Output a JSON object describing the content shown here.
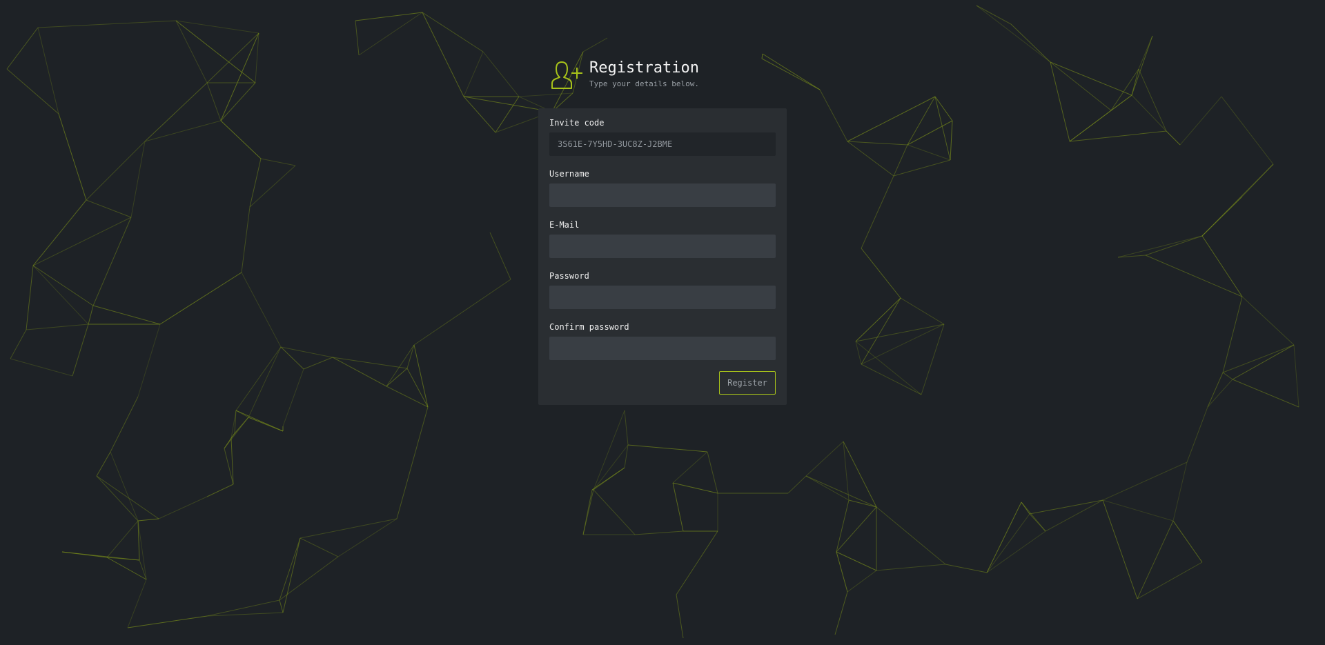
{
  "header": {
    "icon": "add-user-icon",
    "title": "Registration",
    "subtitle": "Type your details below."
  },
  "form": {
    "invite_code": {
      "label": "Invite code",
      "value": "3S61E-7Y5HD-3UC8Z-J2BME"
    },
    "username": {
      "label": "Username",
      "value": ""
    },
    "email": {
      "label": "E-Mail",
      "value": ""
    },
    "password": {
      "label": "Password",
      "value": ""
    },
    "confirm_password": {
      "label": "Confirm password",
      "value": ""
    },
    "register_label": "Register"
  },
  "colors": {
    "background": "#1e2226",
    "card": "#2a2e32",
    "input": "#393e44",
    "accent": "#a7c21a",
    "network_lines": "#7a8f1a"
  }
}
